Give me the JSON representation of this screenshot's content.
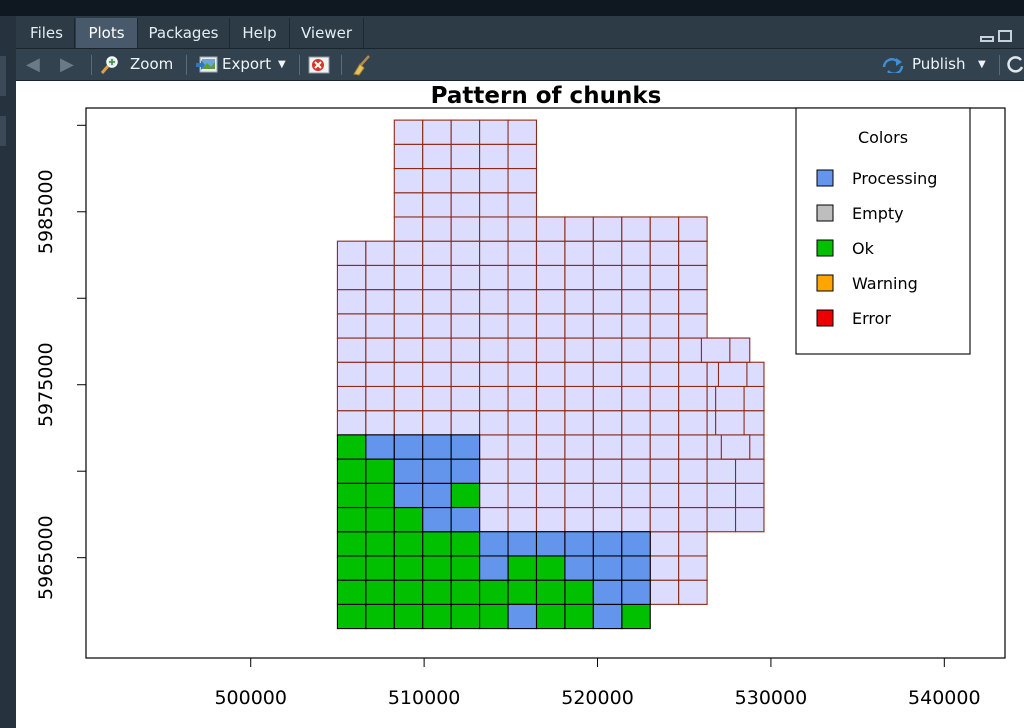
{
  "tabs": [
    {
      "label": "Files",
      "active": false
    },
    {
      "label": "Plots",
      "active": true
    },
    {
      "label": "Packages",
      "active": false
    },
    {
      "label": "Help",
      "active": false
    },
    {
      "label": "Viewer",
      "active": false
    }
  ],
  "toolbar": {
    "zoom_label": "Zoom",
    "export_label": "Export",
    "publish_label": "Publish"
  },
  "icons": {
    "back": "left-arrow-icon",
    "forward": "right-arrow-icon",
    "zoom": "magnifier-icon",
    "export": "image-export-icon",
    "remove": "remove-plot-icon",
    "clear": "broom-icon",
    "publish": "publish-icon",
    "refresh": "refresh-icon"
  },
  "chart_data": {
    "type": "heatmap",
    "title": "Pattern of chunks",
    "xlabel": "",
    "ylabel": "",
    "xlim": [
      490500,
      543500
    ],
    "ylim": [
      5959200,
      5991000
    ],
    "xticks": [
      500000,
      510000,
      520000,
      530000,
      540000
    ],
    "xtick_labels": [
      "500000",
      "510000",
      "520000",
      "530000",
      "540000"
    ],
    "yticks": [
      5965000,
      5975000,
      5985000
    ],
    "ytick_labels": [
      "5965000",
      "5975000",
      "5985000"
    ],
    "yminor_ticks": [
      5970000,
      5980000,
      5990000
    ],
    "grid": false,
    "chunk_origin": [
      505000,
      5960900
    ],
    "chunk_width": 1640,
    "chunk_height": 1400,
    "status_colors": {
      "Processing": "#6495ed",
      "Empty": "#bebebe",
      "Ok": "#00c000",
      "Warning": "#ffa500",
      "Error": "#ee0000",
      "Pending": "#dcdcff"
    },
    "pending_border": "#8b2a1a",
    "done_border": "#000000",
    "legend": {
      "title": "Colors",
      "placement": "top-right",
      "items": [
        {
          "label": "Processing",
          "color": "#6495ed"
        },
        {
          "label": "Empty",
          "color": "#bebebe"
        },
        {
          "label": "Ok",
          "color": "#00c000"
        },
        {
          "label": "Warning",
          "color": "#ffa500"
        },
        {
          "label": "Error",
          "color": "#ee0000"
        }
      ]
    },
    "rows_note": "grid of chunks, row 0 = bottom; each row lists [col_start, col_end] spans",
    "pending_rows": [
      {
        "row": 0,
        "spans": []
      },
      {
        "row": 1,
        "spans": [
          [
            11,
            12
          ]
        ]
      },
      {
        "row": 2,
        "spans": [
          [
            11,
            12
          ]
        ]
      },
      {
        "row": 3,
        "spans": [
          [
            5,
            12
          ]
        ]
      },
      {
        "row": 4,
        "spans": [
          [
            5,
            14
          ]
        ]
      },
      {
        "row": 5,
        "spans": [
          [
            5,
            14
          ]
        ]
      },
      {
        "row": 6,
        "spans": [
          [
            5,
            14
          ]
        ]
      },
      {
        "row": 7,
        "spans": [
          [
            0,
            14
          ]
        ]
      },
      {
        "row": 8,
        "spans": [
          [
            0,
            14
          ]
        ]
      },
      {
        "row": 9,
        "spans": [
          [
            0,
            14
          ]
        ]
      },
      {
        "row": 10,
        "spans": [
          [
            0,
            14
          ]
        ]
      },
      {
        "row": 11,
        "spans": [
          [
            0,
            12
          ]
        ]
      },
      {
        "row": 12,
        "spans": [
          [
            0,
            12
          ]
        ]
      },
      {
        "row": 13,
        "spans": [
          [
            0,
            12
          ]
        ]
      },
      {
        "row": 14,
        "spans": [
          [
            0,
            12
          ]
        ]
      },
      {
        "row": 15,
        "spans": [
          [
            0,
            12
          ]
        ]
      },
      {
        "row": 16,
        "spans": [
          [
            2,
            12
          ]
        ]
      },
      {
        "row": 17,
        "spans": [
          [
            2,
            6
          ]
        ]
      },
      {
        "row": 18,
        "spans": [
          [
            2,
            6
          ]
        ]
      },
      {
        "row": 19,
        "spans": [
          [
            2,
            6
          ]
        ]
      },
      {
        "row": 20,
        "spans": [
          [
            2,
            6
          ]
        ]
      }
    ],
    "extra_cells": [
      {
        "row": 7,
        "col": 13.5
      },
      {
        "row": 8,
        "col": 13.3
      },
      {
        "row": 9,
        "col": 13.3
      },
      {
        "row": 10,
        "col": 13.4
      },
      {
        "row": 11,
        "col": 13.5
      },
      {
        "row": 11,
        "col": 12.8
      }
    ],
    "status_cells": {
      "Ok": [
        [
          0,
          0
        ],
        [
          0,
          1
        ],
        [
          0,
          2
        ],
        [
          0,
          3
        ],
        [
          0,
          4
        ],
        [
          0,
          5
        ],
        [
          0,
          7
        ],
        [
          0,
          8
        ],
        [
          0,
          10
        ],
        [
          1,
          0
        ],
        [
          1,
          1
        ],
        [
          1,
          2
        ],
        [
          1,
          3
        ],
        [
          1,
          4
        ],
        [
          1,
          5
        ],
        [
          1,
          6
        ],
        [
          1,
          7
        ],
        [
          1,
          8
        ],
        [
          2,
          0
        ],
        [
          2,
          1
        ],
        [
          2,
          2
        ],
        [
          2,
          3
        ],
        [
          2,
          4
        ],
        [
          2,
          6
        ],
        [
          2,
          7
        ],
        [
          3,
          0
        ],
        [
          3,
          1
        ],
        [
          3,
          2
        ],
        [
          3,
          3
        ],
        [
          3,
          4
        ],
        [
          4,
          0
        ],
        [
          4,
          1
        ],
        [
          4,
          2
        ],
        [
          5,
          0
        ],
        [
          5,
          1
        ],
        [
          5,
          4
        ],
        [
          6,
          0
        ],
        [
          6,
          1
        ],
        [
          7,
          0
        ]
      ],
      "Processing": [
        [
          0,
          6
        ],
        [
          0,
          9
        ],
        [
          1,
          9
        ],
        [
          1,
          10
        ],
        [
          2,
          5
        ],
        [
          2,
          8
        ],
        [
          2,
          9
        ],
        [
          2,
          10
        ],
        [
          3,
          5
        ],
        [
          3,
          6
        ],
        [
          3,
          7
        ],
        [
          3,
          8
        ],
        [
          3,
          9
        ],
        [
          3,
          10
        ],
        [
          4,
          3
        ],
        [
          4,
          4
        ],
        [
          5,
          2
        ],
        [
          5,
          3
        ],
        [
          6,
          2
        ],
        [
          6,
          3
        ],
        [
          6,
          4
        ],
        [
          7,
          1
        ],
        [
          7,
          2
        ],
        [
          7,
          3
        ],
        [
          7,
          4
        ]
      ]
    }
  }
}
